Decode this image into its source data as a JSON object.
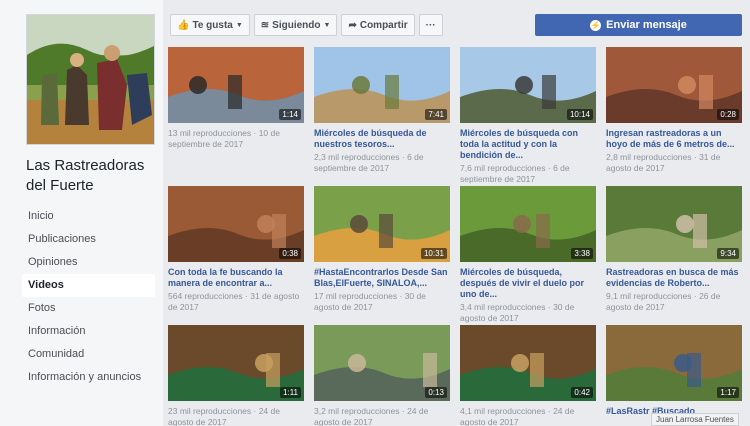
{
  "page": {
    "name": "Las Rastreadoras del Fuerte",
    "nav": [
      "Inicio",
      "Publicaciones",
      "Opiniones",
      "Videos",
      "Fotos",
      "Información",
      "Comunidad",
      "Información y anuncios"
    ],
    "active_nav": "Videos"
  },
  "toolbar": {
    "like_label": "Te gusta",
    "follow_label": "Siguiendo",
    "share_label": "Compartir",
    "more_label": "···",
    "message_label": "Enviar mensaje"
  },
  "videos": [
    {
      "duration": "1:14",
      "title": "",
      "meta": "13 mil reproducciones · 10 de septiembre de 2017"
    },
    {
      "duration": "7:41",
      "title": "Miércoles de búsqueda de nuestros tesoros...",
      "meta": "2,3 mil reproducciones · 6 de septiembre de 2017"
    },
    {
      "duration": "10:14",
      "title": "Miércoles de búsqueda con toda la actitud y con la bendición de...",
      "meta": "7,6 mil reproducciones · 6 de septiembre de 2017"
    },
    {
      "duration": "0:28",
      "title": "Ingresan rastreadoras a un hoyo de más de 6 metros de...",
      "meta": "2,8 mil reproducciones · 31 de agosto de 2017"
    },
    {
      "duration": "0:38",
      "title": "Con toda la fe buscando la manera de encontrar a...",
      "meta": "564 reproducciones · 31 de agosto de 2017"
    },
    {
      "duration": "10:31",
      "title": "#HastaEncontrarlos Desde San Blas,ElFuerte, SINALOA,...",
      "meta": "17 mil reproducciones · 30 de agosto de 2017"
    },
    {
      "duration": "3:38",
      "title": "Miércoles de búsqueda, después de vivir el duelo por uno de...",
      "meta": "3,4 mil reproducciones · 30 de agosto de 2017"
    },
    {
      "duration": "9:34",
      "title": "Rastreadoras en busca de más evidencias de Roberto...",
      "meta": "9,1 mil reproducciones · 26 de agosto de 2017"
    },
    {
      "duration": "1:11",
      "title": "",
      "meta": "23 mil reproducciones · 24 de agosto de 2017"
    },
    {
      "duration": "0:13",
      "title": "",
      "meta": "3,2 mil reproducciones · 24 de agosto de 2017"
    },
    {
      "duration": "0:42",
      "title": "",
      "meta": "4,1 mil reproducciones · 24 de agosto de 2017"
    },
    {
      "duration": "1:17",
      "title": "#LasRastr #Buscado",
      "meta": ""
    }
  ],
  "tooltip": "Juan Larrosa Fuentes",
  "colors": {
    "accent": "#4267b2",
    "link": "#365899",
    "muted": "#90949c"
  }
}
